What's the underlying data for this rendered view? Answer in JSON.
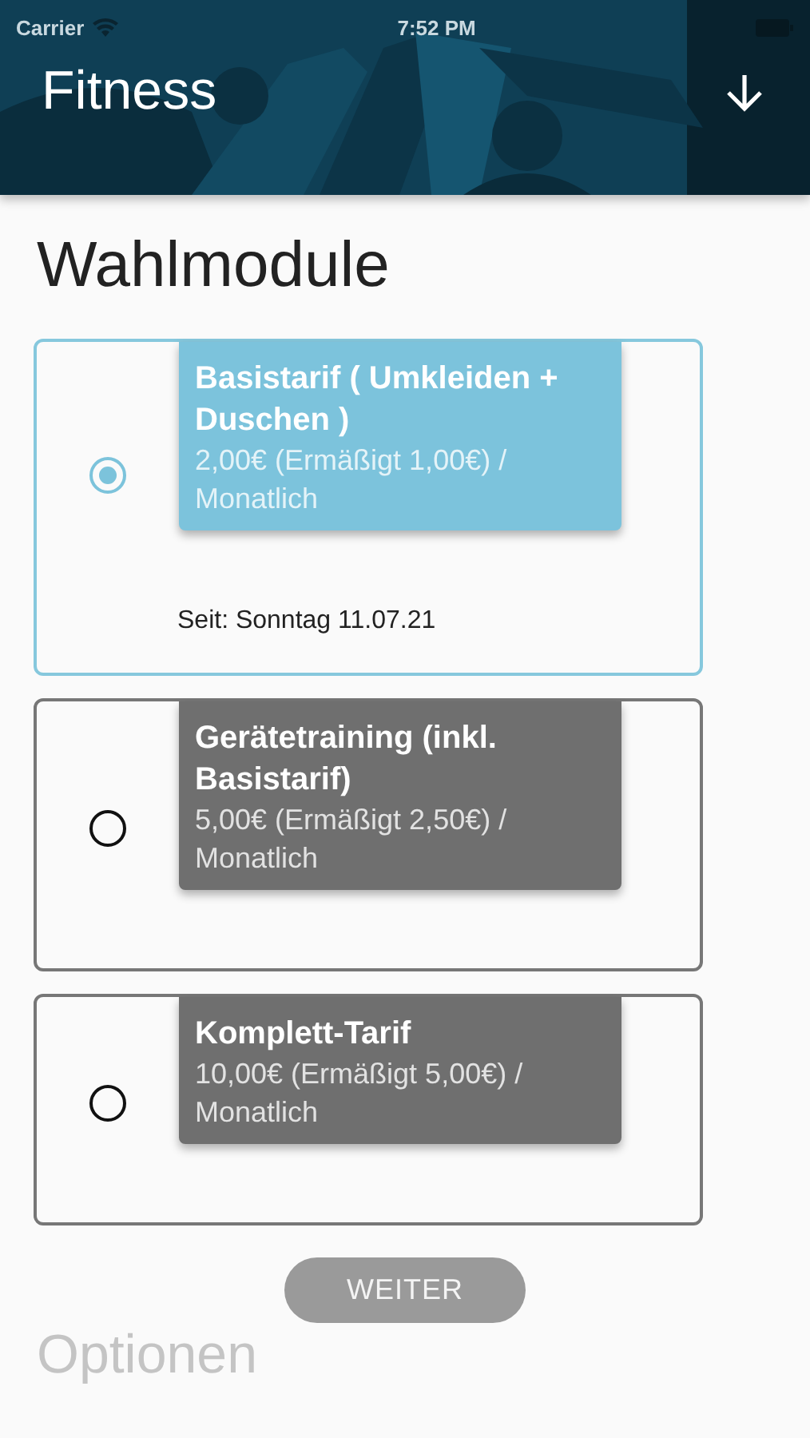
{
  "status_bar": {
    "carrier": "Carrier",
    "time": "7:52 PM"
  },
  "header": {
    "title": "Fitness"
  },
  "section_title": "Wahlmodule",
  "modules": [
    {
      "title": "Basistarif ( Umkleiden + Duschen )",
      "price": "2,00€ (Ermäßigt 1,00€) / Monatlich",
      "selected": true,
      "since": "Seit: Sonntag 11.07.21"
    },
    {
      "title": "Gerätetraining (inkl. Basistarif)",
      "price": "5,00€ (Ermäßigt 2,50€) / Monatlich",
      "selected": false
    },
    {
      "title": "Komplett-Tarif",
      "price": "10,00€ (Ermäßigt 5,00€) / Monatlich",
      "selected": false
    }
  ],
  "button": {
    "label": "WEITER",
    "disabled": true
  },
  "next_section_title": "Optionen"
}
